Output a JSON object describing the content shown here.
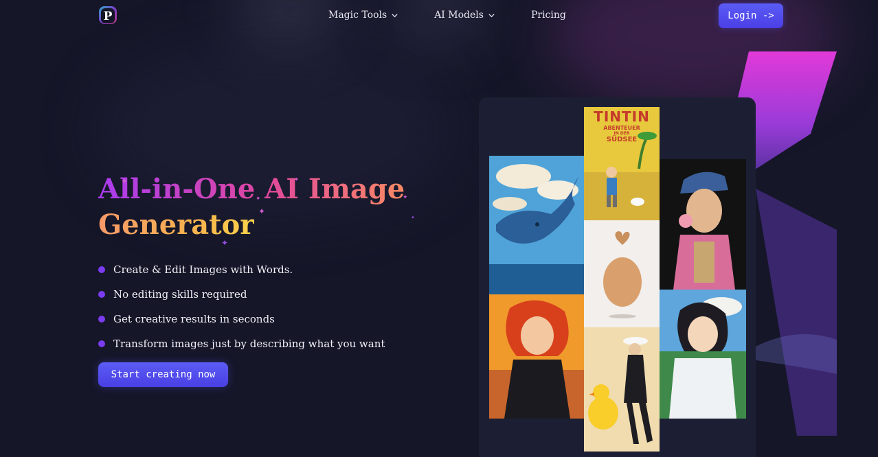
{
  "header": {
    "nav": [
      {
        "label": "Magic Tools",
        "has_dropdown": true
      },
      {
        "label": "AI Models",
        "has_dropdown": true
      },
      {
        "label": "Pricing",
        "has_dropdown": false
      }
    ],
    "login_label": "Login ->"
  },
  "hero": {
    "title_line1": "All-in-One AI Image",
    "title_line2": "Generator",
    "features": [
      "Create & Edit Images with Words.",
      "No editing skills required",
      "Get creative results in seconds",
      "Transform images just by describing what you want"
    ],
    "cta_label": "Start creating now"
  },
  "gallery": {
    "tintin_title": "TINTIN",
    "tintin_subtitle1": "ABENTEUER",
    "tintin_subtitle2": "IN DER",
    "tintin_subtitle3": "SÜDSEE"
  },
  "colors": {
    "background": "#151628",
    "accent": "#5b5cf5",
    "bullet": "#7b3cf0"
  }
}
